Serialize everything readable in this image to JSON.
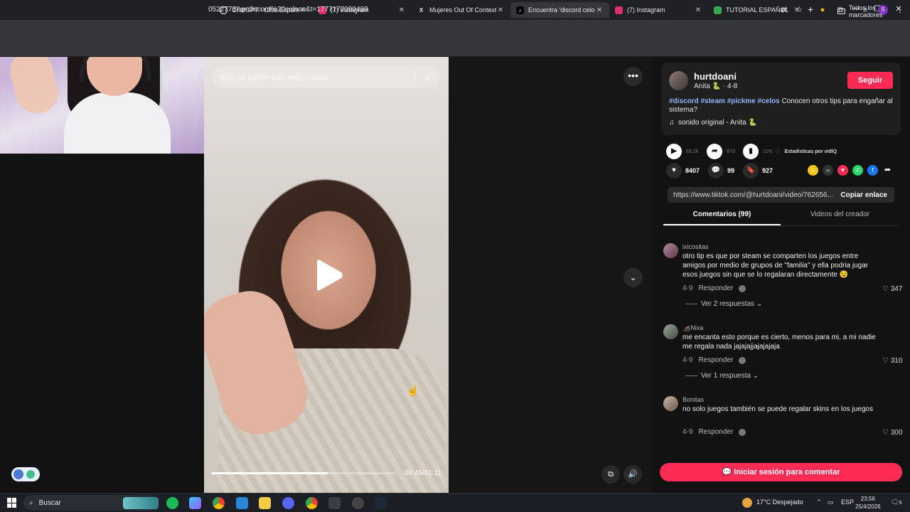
{
  "browser": {
    "tabs": [
      {
        "label": "ChatGPT - Chat Español",
        "icon": "chatgpt-icon",
        "color": "#ffffff"
      },
      {
        "label": "(7) Instagram",
        "icon": "instagram-icon",
        "color": "#e1306c"
      },
      {
        "label": "Mujeres Out Of Context e",
        "icon": "x-icon",
        "color": "#ffffff"
      },
      {
        "label": "Encuentra 'discord celoso",
        "icon": "tiktok-icon",
        "color": "#ffffff"
      },
      {
        "label": "(7) Instagram",
        "icon": "instagram-icon",
        "color": "#e1306c"
      },
      {
        "label": "TUTORIAL ESPAÑOL",
        "icon": "sheets-icon",
        "color": "#34a853"
      }
    ],
    "url": "0522773?q=discord%20celoso&t=1777172099469",
    "bookmarks_label": "Todos los marcadores",
    "profile_initial": "S"
  },
  "video": {
    "search_placeholder": "Buscar contenido relacionado",
    "progress": 0.63,
    "timecode": "00:45/01:11"
  },
  "post": {
    "username": "hurtdoani",
    "nickname": "Anita 🐍 · 4-8",
    "follow_label": "Seguir",
    "hashtags": [
      "#discord",
      "#steam",
      "#pickme",
      "#celos"
    ],
    "caption": "Conocen otros tips para engañar al sistema?",
    "music": "sonido original - Anita 🐍",
    "stats": {
      "plays": "83.2K",
      "shares_stat": "873",
      "engagement": "11%",
      "vidiq_label": "Estadísticas por vidIQ"
    },
    "likes": "8407",
    "comments": "99",
    "saves": "927",
    "link": "https://www.tiktok.com/@hurtdoani/video/762656...",
    "copy_label": "Copiar enlace"
  },
  "comment_tabs": {
    "comments": "Comentarios (99)",
    "creator_videos": "Videos del creador"
  },
  "comments": [
    {
      "user": "ixicositas",
      "text": "otro tip es que por steam se comparten los juegos entre amigos por medio de grupos de \"familia\" y ella podria jugar esos juegos sin que se lo regalaran directamente 😉",
      "date": "4-9",
      "reply_label": "Responder",
      "likes": "347",
      "replies": "Ver 2 respuestas"
    },
    {
      "user": "🦽Nixa",
      "text": "me encanta esto porque es cierto, menos para mi, a mi nadie me regala nada jajajajjajajajaja",
      "date": "4-9",
      "reply_label": "Responder",
      "likes": "310",
      "replies": "Ver 1 respuesta"
    },
    {
      "user": "Bonitas",
      "text": "no solo juegos también se puede regalar skins en los juegos",
      "date": "4-9",
      "reply_label": "Responder",
      "likes": "300"
    }
  ],
  "login_label": "Iniciar sesión para comentar",
  "taskbar": {
    "search_label": "Buscar",
    "weather": "17°C  Despejado",
    "lang": "ESP",
    "time": "23:56",
    "date": "25/4/2026",
    "notif_count": "5"
  },
  "colors": {
    "accent": "#fe2c55",
    "hashtag": "#8fb6ff"
  }
}
